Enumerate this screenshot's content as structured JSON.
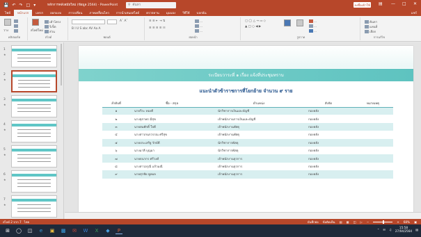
{
  "titlebar": {
    "qat_icons": [
      "save-icon",
      "undo-icon",
      "redo-icon",
      "present-icon",
      "customize-icon"
    ],
    "doc_title": "หลักการคลังสมัยใหม่ (ข้อมูล 2564) - PowerPoint",
    "search_placeholder": "ค้นหา",
    "signin_label": "ลงชื่อเข้าใช้",
    "window_controls": [
      "ribbon-display-icon",
      "minimize-icon",
      "maximize-icon",
      "close-icon"
    ]
  },
  "ribbon_tabs": [
    "ไฟล์",
    "หน้าแรก",
    "แทรก",
    "ออกแบบ",
    "การเปลี่ยน",
    "ภาพเคลื่อนไหว",
    "การนำเสนอสไลด์",
    "ตรวจทาน",
    "มุมมอง",
    "วิธีใช้",
    "บอกฉัน"
  ],
  "active_tab_index": 1,
  "share_label": "แชร์",
  "ribbon_groups": {
    "clipboard": "คลิปบอร์ด",
    "slides": "สไลด์",
    "font": "ฟอนต์",
    "paragraph": "ย่อหน้า",
    "drawing": "รูปวาด",
    "editing": "การแก้ไข"
  },
  "ribbon_items": {
    "paste": "วาง",
    "new_slide": "สไลด์ใหม่",
    "layout": "เค้าโครง",
    "reset": "รีเซ็ต",
    "section": "ส่วน",
    "font_row": "B I U S abc AV Aa A",
    "shapes": "รูปร่าง",
    "arrange": "จัดเรียง",
    "quick_styles": "สไตล์ด่วน",
    "find": "ค้นหา",
    "replace": "แทนที่",
    "select": "เลือก"
  },
  "slides": [
    {
      "num": "1",
      "selected": false
    },
    {
      "num": "2",
      "selected": true
    },
    {
      "num": "3",
      "selected": false
    },
    {
      "num": "4",
      "selected": false
    },
    {
      "num": "5",
      "selected": false
    },
    {
      "num": "6",
      "selected": false
    },
    {
      "num": "7",
      "selected": false
    }
  ],
  "slide": {
    "banner": "ระเบียบวาระที่ ๑ เรื่อง แจ้งที่ประชุมทราบ",
    "subtitle": "แนะนำตัวข้าราชการที่โยกย้าย จำนวน ๙ ราย",
    "columns": [
      "ลำดับที่",
      "ชื่อ - สกุล",
      "ตำแหน่ง",
      "สังกัด",
      "หมายเหตุ"
    ],
    "rows": [
      [
        "๑",
        "นายวีระ ทองดี",
        "นักวิชาการเงินและบัญชี",
        "กองคลัง",
        ""
      ],
      [
        "๒",
        "นางสุภาพร มีสุข",
        "เจ้าพนักงานการเงินและบัญชี",
        "กองคลัง",
        ""
      ],
      [
        "๓",
        "นายสมศักดิ์ ใจดี",
        "เจ้าพนักงานพัสดุ",
        "กองคลัง",
        ""
      ],
      [
        "๔",
        "นางสาวกนกวรรณ ศรีสุข",
        "เจ้าพนักงานพัสดุ",
        "กองคลัง",
        ""
      ],
      [
        "๕",
        "นายประเสริฐ รักษ์ดี",
        "นักวิชาการพัสดุ",
        "กองคลัง",
        ""
      ],
      [
        "๖",
        "นางมาลี บุญมา",
        "นักวิชาการพัสดุ",
        "กองคลัง",
        ""
      ],
      [
        "๗",
        "นายธนากร ศรีวงศ์",
        "เจ้าพนักงานธุรการ",
        "กองคลัง",
        ""
      ],
      [
        "๘",
        "นางสาวอรุณี แก้วมณี",
        "เจ้าพนักงานธุรการ",
        "กองคลัง",
        ""
      ],
      [
        "๙",
        "นายสุรชัย พูลผล",
        "เจ้าพนักงานธุรการ",
        "กองคลัง",
        ""
      ]
    ]
  },
  "status": {
    "slide_info": "สไลด์ 2 จาก 7",
    "language": "ไทย",
    "notes": "บันทึกย่อ",
    "comments": "ข้อคิดเห็น",
    "zoom": "68%"
  },
  "taskbar": {
    "apps": [
      "windows-start-icon",
      "search-icon",
      "task-view-icon",
      "edge-icon",
      "explorer-icon",
      "store-icon",
      "mail-icon",
      "word-icon",
      "excel-icon",
      "photos-icon",
      "powerpoint-icon"
    ],
    "time": "15:58",
    "date": "27/04/2564"
  }
}
